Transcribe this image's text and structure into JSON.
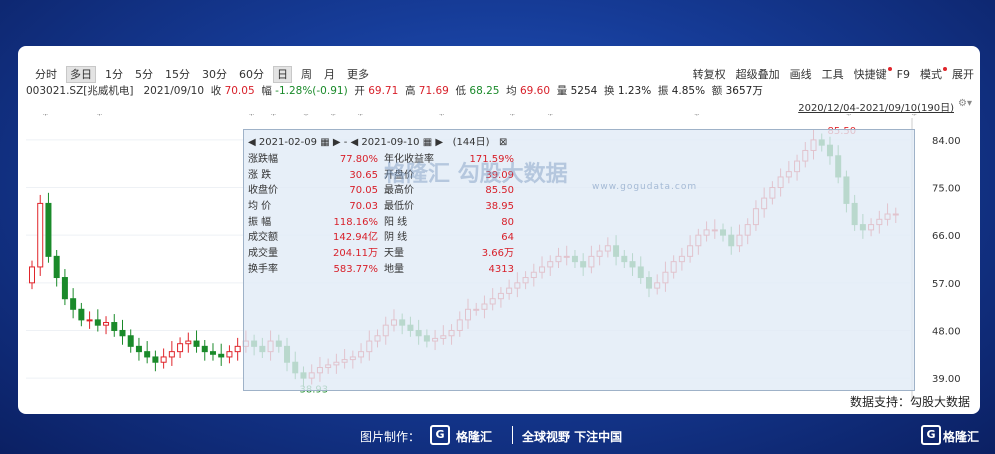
{
  "toolbar": {
    "left": [
      "分时",
      "多日",
      "1分",
      "5分",
      "15分",
      "30分",
      "60分",
      "日",
      "周",
      "月",
      "更多"
    ],
    "right": [
      "转复权",
      "超级叠加",
      "画线",
      "工具",
      "快捷键",
      "F9",
      "模式",
      "展开"
    ]
  },
  "quote": {
    "code": "003021.SZ[兆威机电]",
    "date": "2021/09/10",
    "close_label": "收",
    "close": "70.05",
    "change_label": "幅",
    "change": "-1.28%(-0.91)",
    "open_label": "开",
    "open": "69.71",
    "high_label": "高",
    "high": "71.69",
    "low_label": "低",
    "low": "68.25",
    "avg_label": "均",
    "avg": "69.60",
    "vol_label": "量",
    "vol": "5254",
    "turn_label": "换",
    "turn": "1.23%",
    "amp_label": "振",
    "amp": "4.85%",
    "amt_label": "额",
    "amt": "3657万"
  },
  "range": "2020/12/04-2021/09/10(190日)",
  "stats": {
    "start": "2021-02-09",
    "end": "2021-09-10",
    "days": "(144日)",
    "rows": [
      [
        "涨跌幅",
        "77.80%",
        "年化收益率",
        "171.59%"
      ],
      [
        "涨  跌",
        "30.65",
        "开盘价",
        "39.09"
      ],
      [
        "收盘价",
        "70.05",
        "最高价",
        "85.50"
      ],
      [
        "均  价",
        "70.03",
        "最低价",
        "38.95"
      ],
      [
        "振  幅",
        "118.16%",
        "阳  线",
        "80"
      ],
      [
        "成交额",
        "142.94亿",
        "阴  线",
        "64"
      ],
      [
        "成交量",
        "204.11万",
        "天量",
        "3.66万"
      ],
      [
        "换手率",
        "583.77%",
        "地量",
        "4313"
      ]
    ]
  },
  "watermark": "格隆汇  勾股大数据",
  "watermark_url": "www.gogudata.com",
  "credit": "数据支持：勾股大数据",
  "footer": {
    "made_by": "图片制作：",
    "brand": "格隆汇",
    "slogan": "全球视野 下注中国"
  },
  "chart_data": {
    "type": "candlestick",
    "y_ticks": [
      "84.00",
      "75.00",
      "66.00",
      "57.00",
      "48.00",
      "39.00"
    ],
    "ylim": [
      36,
      87
    ],
    "max_label": "85.50",
    "min_label": "38.93",
    "colors": {
      "up": "#e0252b",
      "down": "#1a8a2a"
    },
    "closes": [
      60,
      72,
      62,
      58,
      54,
      52,
      50,
      50,
      49,
      49.5,
      48,
      47,
      45,
      44,
      43,
      42,
      43,
      44,
      45.5,
      46,
      45,
      44,
      43.5,
      43,
      44,
      45,
      46,
      45,
      44,
      46,
      45,
      42,
      40,
      39,
      40,
      41,
      41.5,
      42,
      42.5,
      43,
      44,
      46,
      47,
      49,
      50,
      49,
      48,
      47,
      46,
      46.5,
      47,
      48,
      50,
      52,
      52,
      53,
      54,
      55,
      56,
      57,
      58,
      59,
      60,
      61,
      62,
      62,
      61,
      60,
      62,
      63,
      64,
      62,
      61,
      60,
      58,
      56,
      57,
      59,
      61,
      62,
      64,
      66,
      67,
      67,
      66,
      64,
      66,
      68,
      71,
      73,
      75,
      77,
      78,
      80,
      82,
      84,
      83,
      81,
      77,
      72,
      68,
      67,
      68,
      69,
      70,
      70
    ]
  }
}
